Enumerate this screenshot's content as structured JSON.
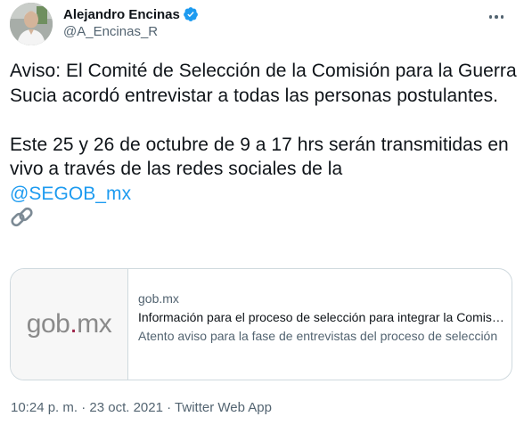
{
  "author": {
    "display_name": "Alejandro Encinas",
    "handle": "@A_Encinas_R",
    "verified": true
  },
  "tweet": {
    "paragraph1": "Aviso: El Comité de Selección de la Comisión para la Guerra Sucia acordó entrevistar a todas las personas postulantes.",
    "paragraph2": "Este 25 y 26 de octubre de 9 a 17 hrs serán transmitidas en vivo a través de las redes sociales de la",
    "mention": "@SEGOB_mx",
    "link_emoji": "link-icon"
  },
  "card": {
    "logo_text_before": "gob",
    "logo_dot": ".",
    "logo_text_after": "mx",
    "domain": "gob.mx",
    "title": "Información para el proceso de selección para integrar la Comisión para la Guerra Sucia",
    "description": "Atento aviso para la fase de entrevistas del proceso de selección"
  },
  "meta": {
    "time": "10:24 p. m.",
    "separator1": " · ",
    "date": "23 oct. 2021",
    "separator2": " · ",
    "source": "Twitter Web App"
  },
  "colors": {
    "accent": "#1d9bf0",
    "text_primary": "#0f1419",
    "text_secondary": "#536471",
    "border": "#cfd9de",
    "gob_dot": "#9d2449"
  }
}
